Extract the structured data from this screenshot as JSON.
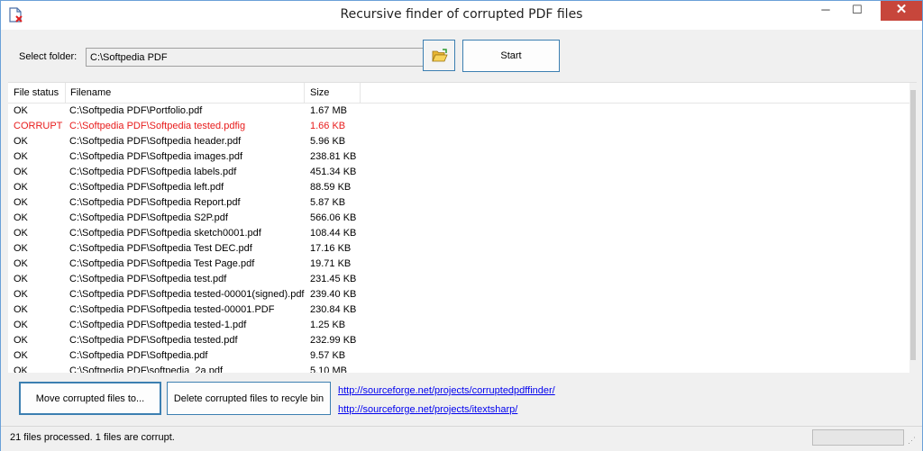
{
  "window": {
    "title": "Recursive finder of corrupted PDF files"
  },
  "folder": {
    "label": "Select folder:",
    "value": "C:\\Softpedia PDF"
  },
  "buttons": {
    "start": "Start",
    "move": "Move corrupted files to...",
    "delete": "Delete corrupted files to recyle bin"
  },
  "list": {
    "columns": {
      "status": "File status",
      "filename": "Filename",
      "size": "Size"
    },
    "rows": [
      {
        "status": "OK",
        "filename": "C:\\Softpedia PDF\\Portfolio.pdf",
        "size": "1.67 MB"
      },
      {
        "status": "CORRUPT",
        "filename": "C:\\Softpedia PDF\\Softpedia tested.pdfig",
        "size": "1.66 KB"
      },
      {
        "status": "OK",
        "filename": "C:\\Softpedia PDF\\Softpedia header.pdf",
        "size": "5.96 KB"
      },
      {
        "status": "OK",
        "filename": "C:\\Softpedia PDF\\Softpedia images.pdf",
        "size": "238.81 KB"
      },
      {
        "status": "OK",
        "filename": "C:\\Softpedia PDF\\Softpedia labels.pdf",
        "size": "451.34 KB"
      },
      {
        "status": "OK",
        "filename": "C:\\Softpedia PDF\\Softpedia left.pdf",
        "size": "88.59 KB"
      },
      {
        "status": "OK",
        "filename": "C:\\Softpedia PDF\\Softpedia Report.pdf",
        "size": "5.87 KB"
      },
      {
        "status": "OK",
        "filename": "C:\\Softpedia PDF\\Softpedia S2P.pdf",
        "size": "566.06 KB"
      },
      {
        "status": "OK",
        "filename": "C:\\Softpedia PDF\\Softpedia sketch0001.pdf",
        "size": "108.44 KB"
      },
      {
        "status": "OK",
        "filename": "C:\\Softpedia PDF\\Softpedia Test DEC.pdf",
        "size": "17.16 KB"
      },
      {
        "status": "OK",
        "filename": "C:\\Softpedia PDF\\Softpedia Test Page.pdf",
        "size": "19.71 KB"
      },
      {
        "status": "OK",
        "filename": "C:\\Softpedia PDF\\Softpedia test.pdf",
        "size": "231.45 KB"
      },
      {
        "status": "OK",
        "filename": "C:\\Softpedia PDF\\Softpedia tested-00001(signed).pdf",
        "size": "239.40 KB"
      },
      {
        "status": "OK",
        "filename": "C:\\Softpedia PDF\\Softpedia tested-00001.PDF",
        "size": "230.84 KB"
      },
      {
        "status": "OK",
        "filename": "C:\\Softpedia PDF\\Softpedia tested-1.pdf",
        "size": "1.25 KB"
      },
      {
        "status": "OK",
        "filename": "C:\\Softpedia PDF\\Softpedia tested.pdf",
        "size": "232.99 KB"
      },
      {
        "status": "OK",
        "filename": "C:\\Softpedia PDF\\Softpedia.pdf",
        "size": "9.57 KB"
      },
      {
        "status": "OK",
        "filename": "C:\\Softpedia PDF\\softpedia_2a.pdf",
        "size": "5.10 MB"
      }
    ]
  },
  "links": [
    "http://sourceforge.net/projects/corruptedpdffinder/",
    "http://sourceforge.net/projects/itextsharp/"
  ],
  "status": {
    "text": "21 files processed. 1 files are corrupt."
  },
  "colors": {
    "corrupt": "#e81c1c",
    "link": "#0000ee",
    "accent": "#3c7fb1",
    "close": "#c7463b"
  },
  "icons": {
    "app": "pdf-error-icon",
    "browse": "folder-open-icon"
  }
}
